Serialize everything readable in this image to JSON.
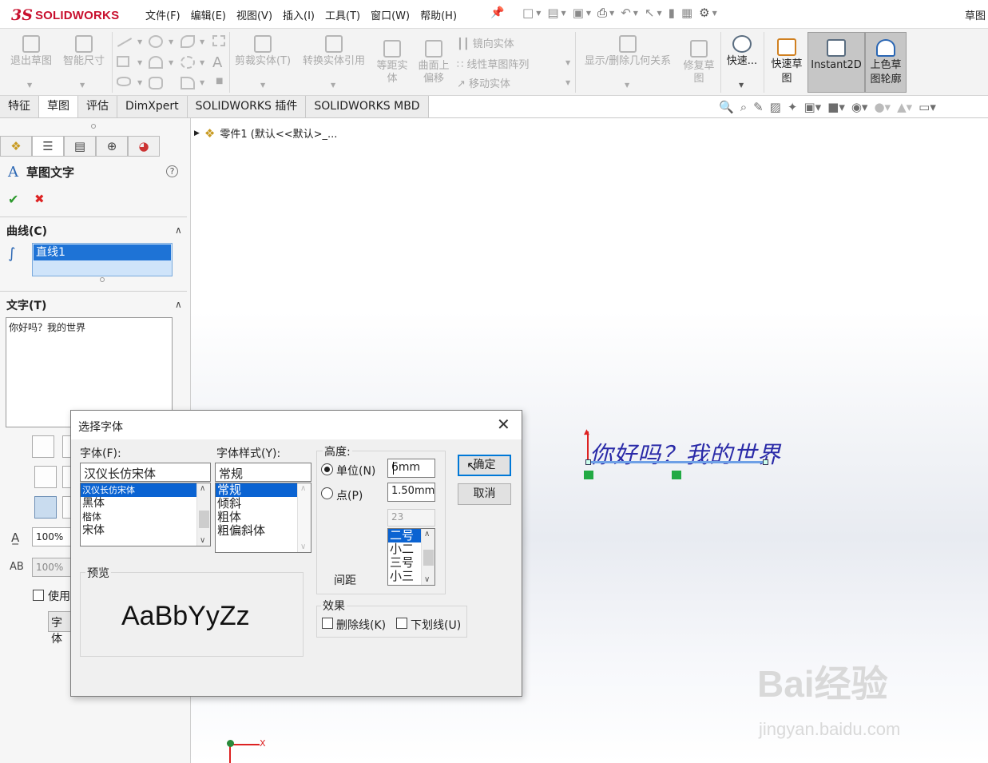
{
  "app": {
    "logo_ds": "3S",
    "logo_name": "SOLIDWORKS",
    "menus": [
      "文件(F)",
      "编辑(E)",
      "视图(V)",
      "插入(I)",
      "工具(T)",
      "窗口(W)",
      "帮助(H)"
    ],
    "doc_mode": "草图"
  },
  "ribbon": {
    "exit_sketch": "退出草图",
    "smart_dim": "智能尺寸",
    "trim": "剪裁实体(T)",
    "convert": "转换实体引用",
    "offset_line1": "等距实",
    "offset_line2": "体",
    "surface_line1": "曲面上",
    "surface_line2": "偏移",
    "mirror": "镜向实体",
    "linear_pattern": "线性草图阵列",
    "move": "移动实体",
    "display_relations": "显示/删除几何关系",
    "repair_line1": "修复草",
    "repair_line2": "图",
    "quick": "快速...",
    "rapid_line1": "快速草",
    "rapid_line2": "图",
    "instant2d": "Instant2D",
    "shaded_line1": "上色草",
    "shaded_line2": "图轮廓"
  },
  "tabs": [
    "特征",
    "草图",
    "评估",
    "DimXpert",
    "SOLIDWORKS 插件",
    "SOLIDWORKS MBD"
  ],
  "active_tab": "草图",
  "tree": {
    "part": "零件1 (默认<<默认>_..."
  },
  "property_manager": {
    "title": "草图文字",
    "curves_label": "曲线(C)",
    "curve_item": "直线1",
    "text_label": "文字(T)",
    "text_value": "你好吗？我的世界",
    "width_factor": "100%",
    "spacing": "100%",
    "use_doc_font": "使用",
    "font_button": "字体"
  },
  "sketch": {
    "text": "你好吗？我的世界",
    "axis_x": "X"
  },
  "dialog": {
    "title": "选择字体",
    "font_label": "字体(F):",
    "font_value": "汉仪长仿宋体",
    "fonts": [
      "汉仪长仿宋体",
      "黑体",
      "楷体",
      "宋体"
    ],
    "selected_font": "汉仪长仿宋体",
    "style_label": "字体样式(Y):",
    "style_value": "常规",
    "styles": [
      "常规",
      "倾斜",
      "粗体",
      "粗偏斜体"
    ],
    "selected_style": "常规",
    "height_label": "高度:",
    "units_label": "单位(N)",
    "units_value": "6mm",
    "points_label": "点(P)",
    "points_value": "1.50mm",
    "size_value": "23",
    "sizes": [
      "二号",
      "小二",
      "三号",
      "小三"
    ],
    "selected_size": "二号",
    "spacing_label": "间距",
    "ok": "确定",
    "cancel": "取消",
    "preview_label": "预览",
    "preview_text": "AaBbYyZz",
    "effects_label": "效果",
    "strikeout": "删除线(K)",
    "underline": "下划线(U)"
  },
  "watermark": {
    "brand": "Bai经验",
    "url": "jingyan.baidu.com"
  },
  "colors": {
    "brand_red": "#c8102e",
    "selection_blue": "#0a63d2",
    "sketch_text": "#2a2aa8",
    "ok_green": "#2e9a2e",
    "cancel_red": "#dd2222"
  }
}
